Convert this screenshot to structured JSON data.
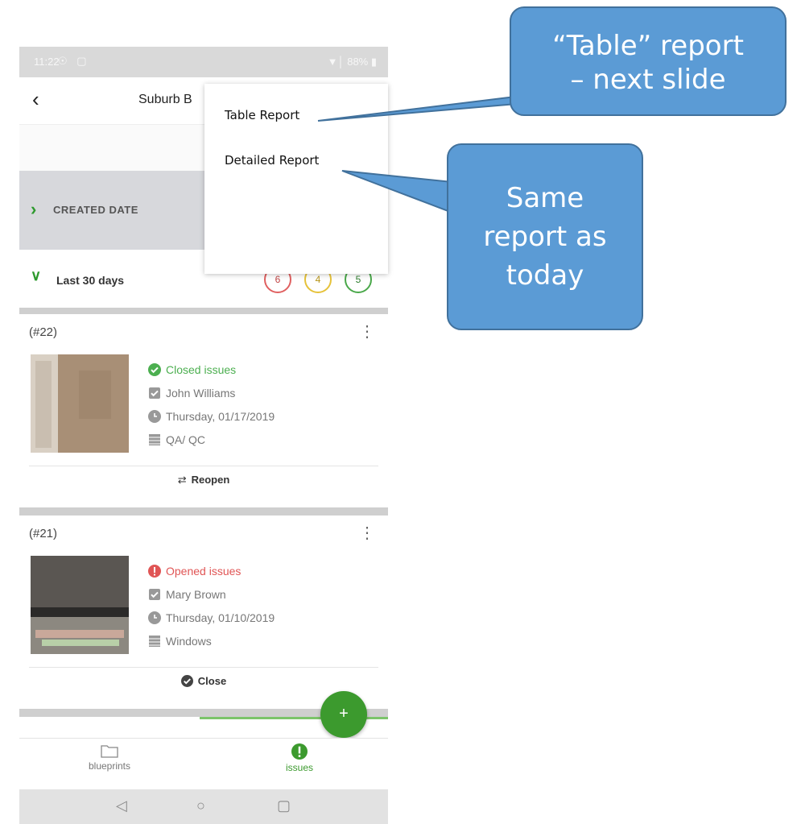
{
  "status_bar": {
    "time": "11:22",
    "left_icons": "☉ ▢",
    "right": "▼│ 88% ▮"
  },
  "app_bar": {
    "title": "Suburb B"
  },
  "filter": {
    "label": "CREATED DATE"
  },
  "range": {
    "label": "Last 30 days",
    "counts": [
      {
        "value": "6",
        "color": "#e06060"
      },
      {
        "value": "4",
        "color": "#e6c23a"
      },
      {
        "value": "5",
        "color": "#4aa84a"
      }
    ]
  },
  "issues": [
    {
      "id": "(#22)",
      "status": "Closed issues",
      "status_color": "#4caf50",
      "assignee": "John Williams",
      "date": "Thursday, 01/17/2019",
      "category": "QA/ QC",
      "action": "Reopen"
    },
    {
      "id": "(#21)",
      "status": "Opened issues",
      "status_color": "#e05555",
      "assignee": "Mary Brown",
      "date": "Thursday, 01/10/2019",
      "category": "Windows",
      "action": "Close"
    }
  ],
  "bottom_nav": {
    "blueprints": "blueprints",
    "issues": "issues"
  },
  "menu": {
    "table_report": "Table Report",
    "detailed_report": "Detailed Report"
  },
  "callouts": {
    "table": [
      "“Table” report",
      "– next slide"
    ],
    "same": [
      "Same",
      "report as",
      "today"
    ]
  },
  "colors": {
    "accent": "#3c9a2e",
    "callout_fill": "#5b9bd5",
    "callout_border": "#41719c"
  }
}
